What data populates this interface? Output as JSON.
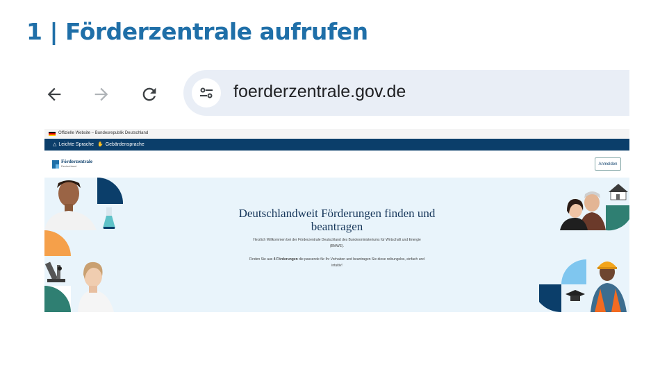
{
  "slide": {
    "title": "1 | Förderzentrale aufrufen"
  },
  "browser": {
    "back_icon": "arrow-left-icon",
    "forward_icon": "arrow-right-icon",
    "reload_icon": "reload-icon",
    "site_settings_icon": "tune-icon",
    "url": "foerderzentrale.gov.de"
  },
  "website": {
    "official_banner": "Offizielle Website – Bundesrepublik Deutschland",
    "accessibility": [
      {
        "label": "Leichte Sprache",
        "icon": "easy-language-icon"
      },
      {
        "label": "Gebärdensprache",
        "icon": "sign-language-icon"
      }
    ],
    "logo": {
      "name": "Förderzentrale",
      "subtitle": "Deutschland"
    },
    "login_label": "Anmelden",
    "hero": {
      "title_line1": "Deutschlandweit Förderungen finden und",
      "title_line2": "beantragen",
      "welcome_line1": "Herzlich Willkommen bei der Förderzentrale Deutschland des Bundesministeriums für Wirtschaft und Energie",
      "welcome_line2": "(BMWE).",
      "find_pre": "Finden Sie aus ",
      "find_bold": "4 Förderungen",
      "find_post": " die passende für Ihr Vorhaben und beantragen Sie diese reibungslos, einfach und",
      "find_line2": "intuitiv!"
    },
    "colors": {
      "navy": "#0b3e6a",
      "teal": "#2f7f72",
      "light_blue": "#7fc6ef",
      "orange": "#f5a04a",
      "hero_bg": "#e9f4fb"
    }
  }
}
